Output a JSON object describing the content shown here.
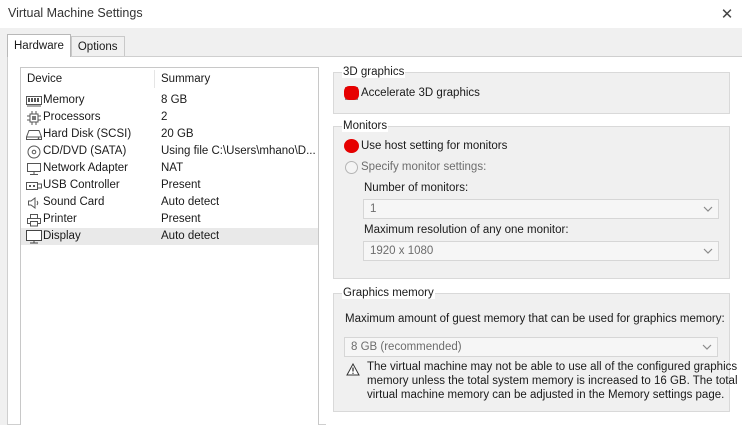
{
  "window": {
    "title": "Virtual Machine Settings"
  },
  "tabs": [
    {
      "label": "Hardware",
      "active": true
    },
    {
      "label": "Options",
      "active": false
    }
  ],
  "device_list": {
    "columns": {
      "device": "Device",
      "summary": "Summary"
    },
    "rows": [
      {
        "device": "Memory",
        "summary": "8 GB",
        "icon": "memory-icon"
      },
      {
        "device": "Processors",
        "summary": "2",
        "icon": "processor-icon"
      },
      {
        "device": "Hard Disk (SCSI)",
        "summary": "20 GB",
        "icon": "hard-disk-icon"
      },
      {
        "device": "CD/DVD (SATA)",
        "summary": "Using file C:\\Users\\mhano\\D...",
        "icon": "cd-dvd-icon"
      },
      {
        "device": "Network Adapter",
        "summary": "NAT",
        "icon": "network-adapter-icon"
      },
      {
        "device": "USB Controller",
        "summary": "Present",
        "icon": "usb-icon"
      },
      {
        "device": "Sound Card",
        "summary": "Auto detect",
        "icon": "speaker-icon"
      },
      {
        "device": "Printer",
        "summary": "Present",
        "icon": "printer-icon"
      },
      {
        "device": "Display",
        "summary": "Auto detect",
        "icon": "monitor-icon",
        "selected": true
      }
    ]
  },
  "graphics3d": {
    "group_label": "3D graphics",
    "accelerate_label": "Accelerate 3D graphics"
  },
  "monitors": {
    "group_label": "Monitors",
    "use_host_label": "Use host setting for monitors",
    "specify_label": "Specify monitor settings:",
    "num_monitors_label": "Number of monitors:",
    "num_monitors_value": "1",
    "max_res_label": "Maximum resolution of any one monitor:",
    "max_res_value": "1920 x 1080"
  },
  "graphics_memory": {
    "group_label": "Graphics memory",
    "description": "Maximum amount of guest memory that can be used for graphics memory:",
    "value": "8 GB (recommended)",
    "warning_line1": "The virtual machine may not be able to use all of the configured graphics",
    "warning_line2": "memory unless the total system memory is increased to 16 GB. The total",
    "warning_line3": "virtual machine memory can be adjusted in the Memory settings page."
  },
  "colors": {
    "annotation_red": "#e60000",
    "selection": "#e9e9e9"
  }
}
